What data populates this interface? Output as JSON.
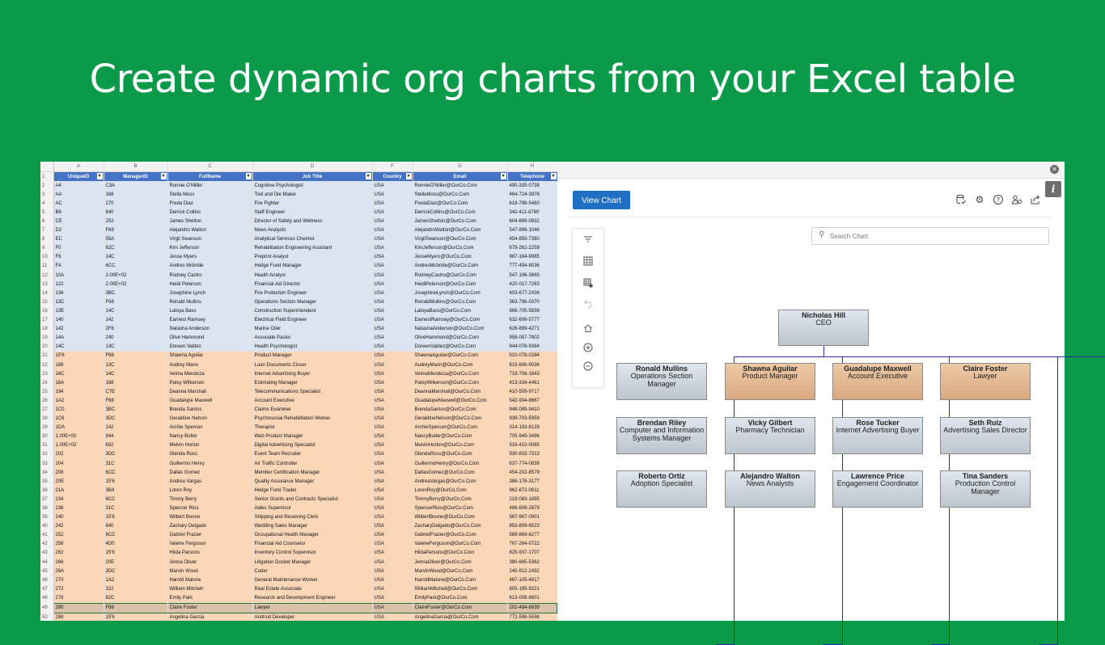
{
  "headline": "Create dynamic org charts from your Excel table",
  "excel": {
    "col_letters": [
      "A",
      "B",
      "C",
      "D",
      "F",
      "G",
      "H"
    ],
    "headers": [
      "UniqueID",
      "ManagerID",
      "FullName",
      "Job Title",
      "Country",
      "Email",
      "Telephone"
    ],
    "rows": [
      {
        "n": "2",
        "style": "blue",
        "c": [
          "A4",
          "C3A",
          "Ronnie O'Miller",
          "Cognitive Psychologist",
          "USA",
          "RonnieO'Miller@OurCo.Com",
          "490-335-0738"
        ]
      },
      {
        "n": "3",
        "style": "blue",
        "c": [
          "AA",
          "168",
          "Stella Moss",
          "Tool and Die Maker",
          "USA",
          "StellaMoss@OurCo.Com",
          "464-724-3978"
        ]
      },
      {
        "n": "4",
        "style": "blue",
        "c": [
          "AC",
          "270",
          "Freda Diaz",
          "Fire Fighter",
          "USA",
          "FredaDiaz@OurCo.Com",
          "618-798-5460"
        ]
      },
      {
        "n": "5",
        "style": "blue",
        "c": [
          "B6",
          "840",
          "Derrick Collins",
          "Staff Engineer",
          "USA",
          "DerrickCollins@OurCo.Com",
          "342-411-6780"
        ]
      },
      {
        "n": "6",
        "style": "blue",
        "c": [
          "CE",
          "252",
          "James Shelton",
          "Director of Safety and Wellness",
          "USA",
          "JamesShelton@OurCo.Com",
          "604-889-0832"
        ]
      },
      {
        "n": "7",
        "style": "blue",
        "c": [
          "D2",
          "F68",
          "Alejandro Walton",
          "News Analysts",
          "USA",
          "AlejandroWalton@OurCo.Com",
          "547-996-1046"
        ]
      },
      {
        "n": "8",
        "style": "blue",
        "c": [
          "EC",
          "55A",
          "Virgil Swanson",
          "Analytical Services Chemist",
          "USA",
          "VirgilSwanson@OurCo.Com",
          "454-855-7380"
        ]
      },
      {
        "n": "9",
        "style": "blue",
        "c": [
          "F0",
          "82C",
          "Kim Jefferson",
          "Rehabilitation Engineering Assistant",
          "USA",
          "KimJefferson@OurCo.Com",
          "679-262-2259"
        ]
      },
      {
        "n": "10",
        "style": "blue",
        "c": [
          "F6",
          "14C",
          "Jesse Myers",
          "Preprint Analyst",
          "USA",
          "JesseMyers@OurCo.Com",
          "987-164-9985"
        ]
      },
      {
        "n": "11",
        "style": "blue",
        "c": [
          "FA",
          "6CC",
          "Andres Mcbride",
          "Hedge Fund Manager",
          "USA",
          "AndresMcbride@OurCo.Com",
          "777-454-8036"
        ]
      },
      {
        "n": "12",
        "style": "blue",
        "c": [
          "10A",
          "2.00E+02",
          "Rodney Castro",
          "Health Analyst",
          "USA",
          "RodneyCastro@OurCo.Com",
          "547-196-3665"
        ]
      },
      {
        "n": "13",
        "style": "blue",
        "c": [
          "122",
          "2.00E+02",
          "Heidi Peterson",
          "Financial Aid Director",
          "USA",
          "HeidiPeterson@OurCo.Com",
          "420-017-7263"
        ]
      },
      {
        "n": "14",
        "style": "blue",
        "c": [
          "136",
          "3BC",
          "Josephine Lynch",
          "Fire Protection Engineer",
          "USA",
          "JosephineLynch@OurCo.Com",
          "403-677-2436"
        ]
      },
      {
        "n": "15",
        "style": "blue",
        "c": [
          "13C",
          "F68",
          "Ronald Mullins",
          "Operations Section Manager",
          "USA",
          "RonaldMullins@OurCo.Com",
          "363-796-0370"
        ]
      },
      {
        "n": "16",
        "style": "blue",
        "c": [
          "13E",
          "14C",
          "Latoya Bass",
          "Construction Superintendent",
          "USA",
          "LatoyaBass@OurCo.Com",
          "866-705-5838"
        ]
      },
      {
        "n": "17",
        "style": "blue",
        "c": [
          "140",
          "142",
          "Earnest Ramsey",
          "Electrical Field Engineer",
          "USA",
          "EarnestRamsey@OurCo.Com",
          "632-606-5777"
        ]
      },
      {
        "n": "18",
        "style": "blue",
        "c": [
          "142",
          "2F6",
          "Natasha Anderson",
          "Marine Oiler",
          "USA",
          "NatashaAnderson@OurCo.Com",
          "626-899-4271"
        ]
      },
      {
        "n": "19",
        "style": "blue",
        "c": [
          "14A",
          "240",
          "Olive Hammond",
          "Associate Pastor",
          "USA",
          "OliveHammond@OurCo.Com",
          "958-057-7802"
        ]
      },
      {
        "n": "20",
        "style": "blue",
        "c": [
          "14C",
          "13C",
          "Doreen Valdez",
          "Health Psychologist",
          "USA",
          "DoreenValdez@OurCo.Com",
          "944-078-9364"
        ]
      },
      {
        "n": "21",
        "style": "orange",
        "c": [
          "15'6",
          "F68",
          "Shawna Aguilar",
          "Product Manager",
          "USA",
          "ShawnaAguilar@OurCo.Com",
          "510-078-0284"
        ]
      },
      {
        "n": "22",
        "style": "orange",
        "c": [
          "168",
          "13C",
          "Audrey Mann",
          "Loan Documents Closer",
          "USA",
          "AudreyMann@OurCo.Com",
          "615-606-9036"
        ]
      },
      {
        "n": "23",
        "style": "orange",
        "c": [
          "16C",
          "14C",
          "Velma Mendoza",
          "Internet Advertising Buyer",
          "USA",
          "VelmaMendoza@OurCo.Com",
          "719-706-1643"
        ]
      },
      {
        "n": "24",
        "style": "orange",
        "c": [
          "18A",
          "168",
          "Patsy Wilkerson",
          "Estimating Manager",
          "USA",
          "PatsyWilkerson@OurCo.Com",
          "413-334-4461"
        ]
      },
      {
        "n": "25",
        "style": "orange",
        "c": [
          "194",
          "C7E",
          "Deanna Marshall",
          "Telecommunications Specialist",
          "USA",
          "DeannaMarshall@OurCo.Com",
          "410-509-9717"
        ]
      },
      {
        "n": "26",
        "style": "orange",
        "c": [
          "1A2",
          "F68",
          "Guadalupe Maxwell",
          "Account Executive",
          "USA",
          "GuadalupeMaxwell@OurCo.Com",
          "542-934-8667"
        ]
      },
      {
        "n": "27",
        "style": "orange",
        "c": [
          "1C0",
          "3BC",
          "Brenda Santos",
          "Claims Examiner",
          "USA",
          "BrendaSantos@OurCo.Com",
          "948-099-9410"
        ]
      },
      {
        "n": "28",
        "style": "orange",
        "c": [
          "1C6",
          "3DC",
          "Geraldine Nelson",
          "Psychosocial Rehabilitation Worker",
          "USA",
          "GeraldineNelson@OurCo.Com",
          "939-703-5959"
        ]
      },
      {
        "n": "29",
        "style": "orange",
        "c": [
          "1DA",
          "142",
          "Archie Spencer",
          "Therapist",
          "USA",
          "ArchieSpencer@OurCo.Com",
          "314-193-8128"
        ]
      },
      {
        "n": "30",
        "style": "orange",
        "c": [
          "1.00E+00",
          "944",
          "Nancy Butler",
          "Web Product Manager",
          "USA",
          "NancyButler@OurCo.Com",
          "705-949-3496"
        ]
      },
      {
        "n": "31",
        "style": "orange",
        "c": [
          "1.00E+02",
          "692",
          "Melvin Horton",
          "Digital Advertising Specialist",
          "USA",
          "MelvinHorton@OurCo.Com",
          "516-410-0085"
        ]
      },
      {
        "n": "32",
        "style": "orange",
        "c": [
          "202",
          "3DC",
          "Glenda Ross",
          "Event Team Recruiter",
          "USA",
          "GlendaRoss@OurCo.Com",
          "930-833-7313"
        ]
      },
      {
        "n": "33",
        "style": "orange",
        "c": [
          "204",
          "31C",
          "Guillermo Henry",
          "Air Traffic Controller",
          "USA",
          "GuillermoHenry@OurCo.Com",
          "637-774-0839"
        ]
      },
      {
        "n": "34",
        "style": "orange",
        "c": [
          "208",
          "6CC",
          "Dallas Gomez",
          "Member Certification Manager",
          "USA",
          "DallasGomez@OurCo.Com",
          "454-202-8579"
        ]
      },
      {
        "n": "35",
        "style": "orange",
        "c": [
          "20E",
          "15'6",
          "Andrea Vargas",
          "Quality Assurance Manager",
          "USA",
          "AndreaVargas@OurCo.Com",
          "386-176-3177"
        ]
      },
      {
        "n": "36",
        "style": "orange",
        "c": [
          "21A",
          "3B4",
          "Loren Roy",
          "Hedge Fund Trader",
          "USA",
          "LorenRoy@OurCo.Com",
          "962-872-0611"
        ]
      },
      {
        "n": "37",
        "style": "orange",
        "c": [
          "234",
          "6CC",
          "Timmy Berry",
          "Senior Grants and Contracts Specialist",
          "USA",
          "TimmyBerry@OurCo.Com",
          "219-083-1895"
        ]
      },
      {
        "n": "38",
        "style": "orange",
        "c": [
          "236",
          "31C",
          "Spencer Rios",
          "Aides Supervisor",
          "USA",
          "SpencerRios@OurCo.Com",
          "486-608-2679"
        ]
      },
      {
        "n": "39",
        "style": "orange",
        "c": [
          "240",
          "15'6",
          "Wilbert Boone",
          "Shipping and Receiving Clerk",
          "USA",
          "WilbertBoone@OurCo.Com",
          "567-967-0901"
        ]
      },
      {
        "n": "40",
        "style": "orange",
        "c": [
          "242",
          "840",
          "Zachary Delgado",
          "Wedding Sales Manager",
          "USA",
          "ZacharyDelgado@OurCo.Com",
          "853-809-6523"
        ]
      },
      {
        "n": "41",
        "style": "orange",
        "c": [
          "252",
          "6CC",
          "Gabriel Frazier",
          "Occupational Health Manager",
          "USA",
          "GabrielFrazier@OurCo.Com",
          "589-869-6277"
        ]
      },
      {
        "n": "42",
        "style": "orange",
        "c": [
          "256",
          "4D0",
          "Valerie Ferguson",
          "Financial Aid Counselor",
          "USA",
          "ValerieFerguson@OurCo.Com",
          "767-264-0722"
        ]
      },
      {
        "n": "43",
        "style": "orange",
        "c": [
          "262",
          "15'6",
          "Hilda Parsons",
          "Inventory Control Supervisor",
          "USA",
          "HildaParsons@OurCo.Com",
          "825-937-1707"
        ]
      },
      {
        "n": "44",
        "style": "orange",
        "c": [
          "266",
          "20E",
          "Jenna Oliver",
          "Litigation Docket Manager",
          "USA",
          "JennaOliver@OurCo.Com",
          "380-665-5362"
        ]
      },
      {
        "n": "45",
        "style": "orange",
        "c": [
          "26A",
          "3DC",
          "Marvin Wood",
          "Coder",
          "USA",
          "MarvinWood@OurCo.Com",
          "240-912-2432"
        ]
      },
      {
        "n": "46",
        "style": "orange",
        "c": [
          "270",
          "1A2",
          "Harold Malone",
          "General Maintenance Worker",
          "USA",
          "HaroldMalone@OurCo.Com",
          "467-105-4917"
        ]
      },
      {
        "n": "47",
        "style": "orange",
        "c": [
          "272",
          "322",
          "William Mitchell",
          "Real Estate Associate",
          "USA",
          "WilliamMitchell@OurCo.Com",
          "805-195-9221"
        ]
      },
      {
        "n": "48",
        "style": "orange",
        "c": [
          "278",
          "82C",
          "Emily Park",
          "Research and Development Engineer",
          "USA",
          "EmilyPark@OurCo.Com",
          "613-008-8601"
        ]
      },
      {
        "n": "49",
        "style": "sel",
        "c": [
          "280",
          "F68",
          "Claire Foster",
          "Lawyer",
          "USA",
          "ClaireFoster@OurCo.Com",
          "202-484-8939"
        ]
      },
      {
        "n": "50",
        "style": "orange",
        "c": [
          "288",
          "15'6",
          "Angelina Garcia",
          "Android Developer",
          "USA",
          "AngelinaGarcia@OurCo.Com",
          "772-598-5598"
        ]
      }
    ]
  },
  "app": {
    "view_chart_label": "View Chart",
    "info_label": "i",
    "search_placeholder": "Search Chart",
    "top_icons": [
      "database-check-icon",
      "gear-icon",
      "help-icon",
      "people-icon",
      "share-icon"
    ],
    "toolbar_icons": [
      "filter-lines-icon",
      "table-icon",
      "table-add-icon",
      "undo-icon",
      "home-icon",
      "zoom-in-icon",
      "zoom-out-icon"
    ],
    "colors": {
      "accent": "#1f6fc5",
      "connector": "#2a2aa6",
      "node_grey": "#c9d1da",
      "node_tan": "#e3b892"
    },
    "root": {
      "name": "Nicholas Hill",
      "role": "CEO"
    },
    "columns": [
      [
        {
          "name": "Ronald Mullins",
          "role": "Operations Section Manager",
          "color": "grey"
        },
        {
          "name": "Brendan Riley",
          "role": "Computer and Information Systems Manager",
          "color": "grey"
        },
        {
          "name": "Roberto Ortiz",
          "role": "Adoption Specialist",
          "color": "grey"
        }
      ],
      [
        {
          "name": "Shawna Aguilar",
          "role": "Product Manager",
          "color": "tan"
        },
        {
          "name": "Vicky Gilbert",
          "role": "Pharmacy Technician",
          "color": "grey"
        },
        {
          "name": "Alejandro Walton",
          "role": "News Analysts",
          "color": "grey"
        }
      ],
      [
        {
          "name": "Guadalupe Maxwell",
          "role": "Account Executive",
          "color": "tan"
        },
        {
          "name": "Rose Tucker",
          "role": "Internet Advertising Buyer",
          "color": "grey"
        },
        {
          "name": "Lawrence Price",
          "role": "Engagement Coordinator",
          "color": "grey"
        }
      ],
      [
        {
          "name": "Claire Foster",
          "role": "Lawyer",
          "color": "tan"
        },
        {
          "name": "Seth Ruiz",
          "role": "Advertising Sales Director",
          "color": "grey"
        },
        {
          "name": "Tina Sanders",
          "role": "Production Control Manager",
          "color": "grey"
        }
      ]
    ]
  }
}
